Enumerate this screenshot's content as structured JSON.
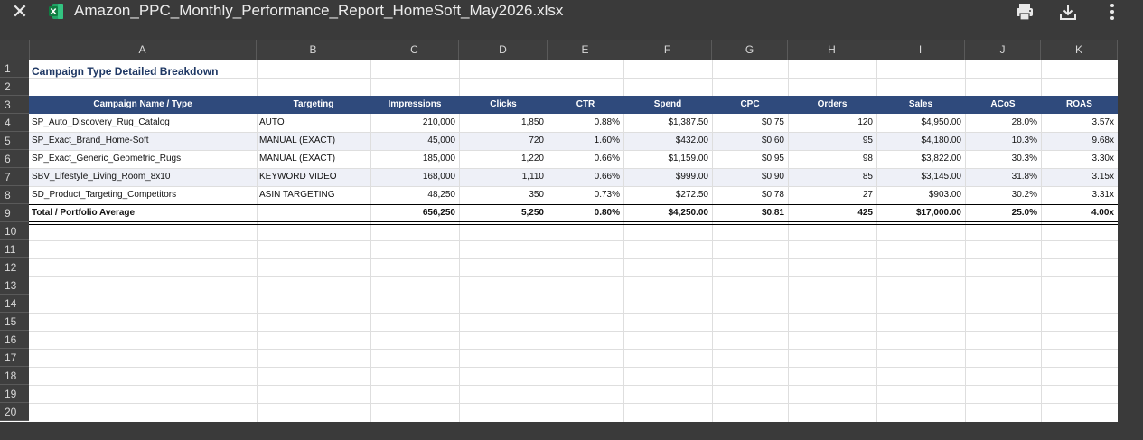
{
  "toolbar": {
    "filename": "Amazon_PPC_Monthly_Performance_Report_HomeSoft_May2026.xlsx",
    "close_icon": "close-icon",
    "file_icon": "excel-file-icon",
    "print_icon": "print-icon",
    "download_icon": "download-icon",
    "more_icon": "more-vertical-icon"
  },
  "columns": [
    "A",
    "B",
    "C",
    "D",
    "E",
    "F",
    "G",
    "H",
    "I",
    "J",
    "K"
  ],
  "rows": [
    "1",
    "2",
    "3",
    "4",
    "5",
    "6",
    "7",
    "8",
    "9",
    "10",
    "11",
    "12",
    "13",
    "14",
    "15",
    "16",
    "17",
    "18",
    "19",
    "20"
  ],
  "sheet": {
    "title": "Campaign Type Detailed Breakdown",
    "headers": [
      "Campaign Name / Type",
      "Targeting",
      "Impressions",
      "Clicks",
      "CTR",
      "Spend",
      "CPC",
      "Orders",
      "Sales",
      "ACoS",
      "ROAS"
    ],
    "data": [
      [
        "SP_Auto_Discovery_Rug_Catalog",
        "AUTO",
        "210,000",
        "1,850",
        "0.88%",
        "$1,387.50",
        "$0.75",
        "120",
        "$4,950.00",
        "28.0%",
        "3.57x"
      ],
      [
        "SP_Exact_Brand_Home-Soft",
        "MANUAL (EXACT)",
        "45,000",
        "720",
        "1.60%",
        "$432.00",
        "$0.60",
        "95",
        "$4,180.00",
        "10.3%",
        "9.68x"
      ],
      [
        "SP_Exact_Generic_Geometric_Rugs",
        "MANUAL (EXACT)",
        "185,000",
        "1,220",
        "0.66%",
        "$1,159.00",
        "$0.95",
        "98",
        "$3,822.00",
        "30.3%",
        "3.30x"
      ],
      [
        "SBV_Lifestyle_Living_Room_8x10",
        "KEYWORD VIDEO",
        "168,000",
        "1,110",
        "0.66%",
        "$999.00",
        "$0.90",
        "85",
        "$3,145.00",
        "31.8%",
        "3.15x"
      ],
      [
        "SD_Product_Targeting_Competitors",
        "ASIN TARGETING",
        "48,250",
        "350",
        "0.73%",
        "$272.50",
        "$0.78",
        "27",
        "$903.00",
        "30.2%",
        "3.31x"
      ]
    ],
    "total": [
      "Total / Portfolio Average",
      "",
      "656,250",
      "5,250",
      "0.80%",
      "$4,250.00",
      "$0.81",
      "425",
      "$17,000.00",
      "25.0%",
      "4.00x"
    ]
  },
  "colors": {
    "header_band": "#2f4a7c",
    "title_text": "#1f3864",
    "alt_row": "#eef0f7"
  }
}
